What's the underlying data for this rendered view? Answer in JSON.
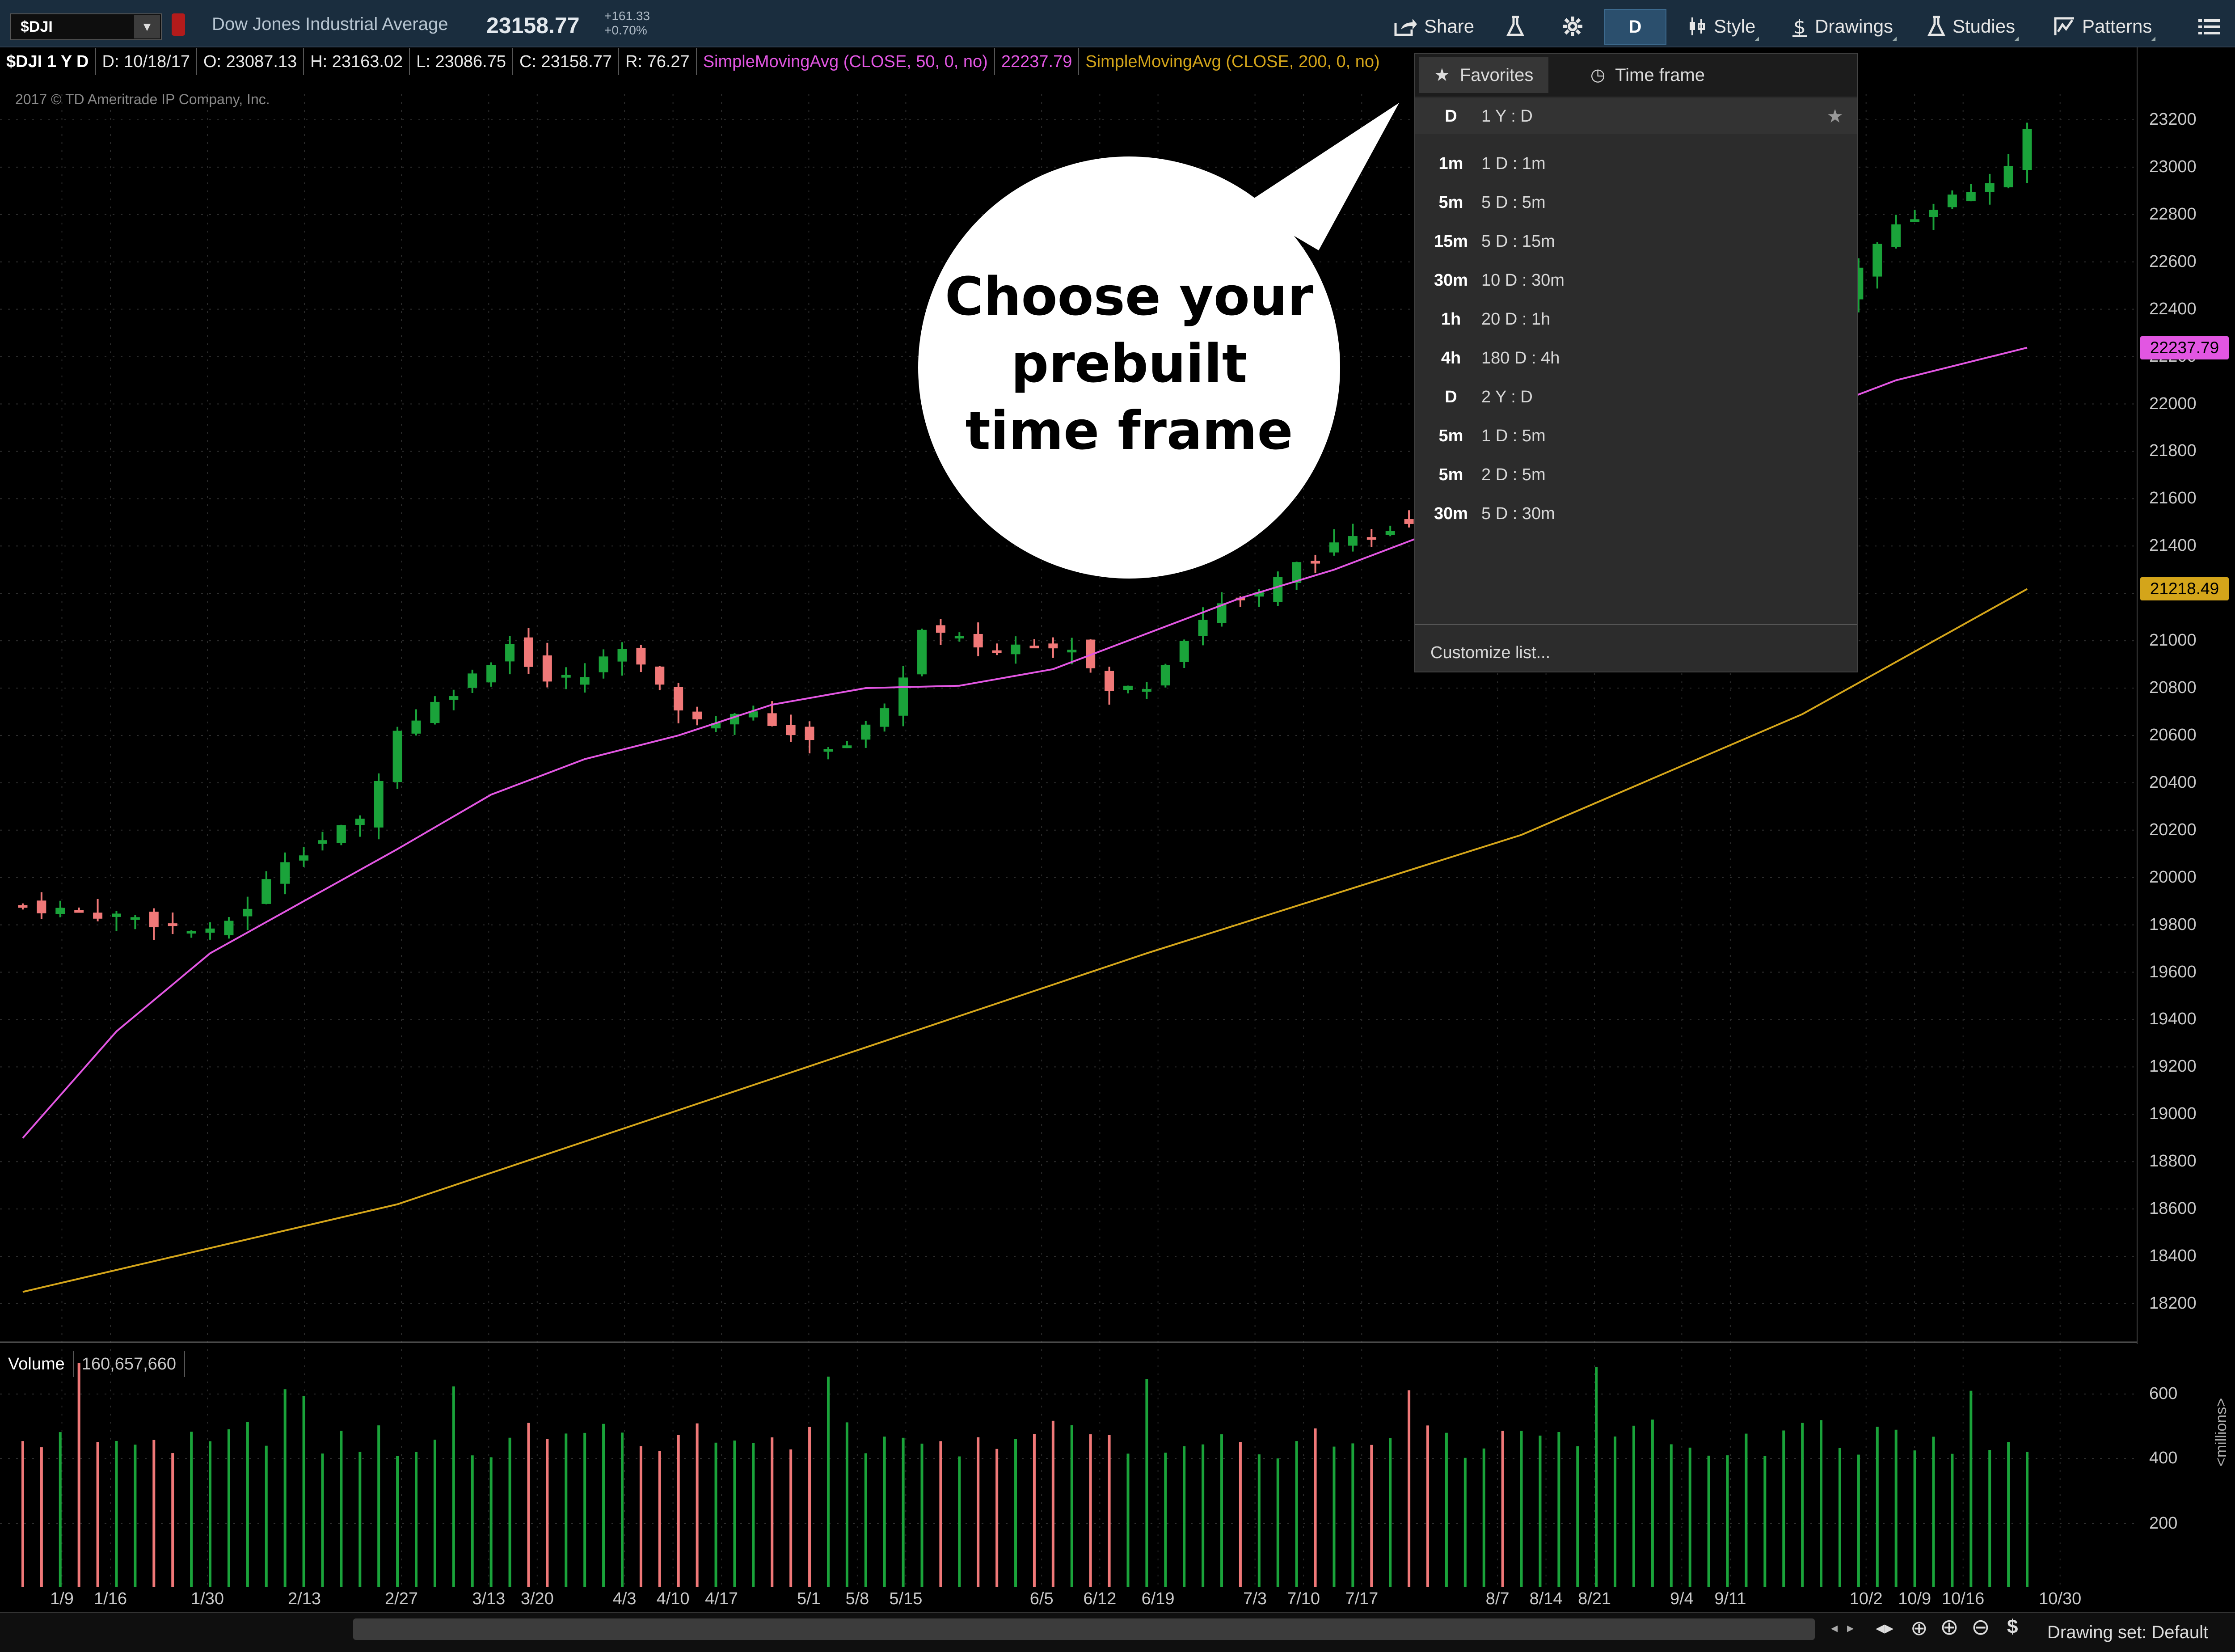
{
  "toolbar": {
    "symbol": "$DJI",
    "name": "Dow Jones Industrial Average",
    "price": "23158.77",
    "change": "+161.33",
    "change_pct": "+0.70%",
    "share": "Share",
    "period": "D",
    "style": "Style",
    "drawings": "Drawings",
    "studies": "Studies",
    "patterns": "Patterns"
  },
  "infobar": {
    "symbol_tf": "$DJI 1 Y D",
    "date": "D: 10/18/17",
    "open": "O: 23087.13",
    "high": "H: 23163.02",
    "low": "L: 23086.75",
    "close": "C: 23158.77",
    "range": "R: 76.27",
    "sma50_label": "SimpleMovingAvg (CLOSE, 50, 0, no)",
    "sma50_value": "22237.79",
    "sma200_label": "SimpleMovingAvg (CLOSE, 200, 0, no)"
  },
  "copyright": "2017 © TD Ameritrade IP Company, Inc.",
  "panel": {
    "tab_favorites": "Favorites",
    "tab_timeframe": "Time frame",
    "favorite": {
      "agg": "D",
      "label": "1 Y : D"
    },
    "items": [
      {
        "agg": "1m",
        "label": "1 D : 1m"
      },
      {
        "agg": "5m",
        "label": "5 D : 5m"
      },
      {
        "agg": "15m",
        "label": "5 D : 15m"
      },
      {
        "agg": "30m",
        "label": "10 D : 30m"
      },
      {
        "agg": "1h",
        "label": "20 D : 1h"
      },
      {
        "agg": "4h",
        "label": "180 D : 4h"
      },
      {
        "agg": "D",
        "label": "2 Y : D"
      },
      {
        "agg": "5m",
        "label": "1 D : 5m"
      },
      {
        "agg": "5m",
        "label": "2 D : 5m"
      },
      {
        "agg": "30m",
        "label": "5 D : 30m"
      }
    ],
    "customize": "Customize list..."
  },
  "callout": {
    "line1": "Choose your",
    "line2": "prebuilt",
    "line3": "time frame"
  },
  "volume": {
    "label": "Volume",
    "value": "160,657,660",
    "unit": "<millions>"
  },
  "status": {
    "drawing_set": "Drawing set: Default"
  },
  "colors": {
    "up": "#1aa33a",
    "down": "#f07878",
    "sma50": "#e256e2",
    "sma200": "#d4a51a",
    "panel_bg": "#2c2c2c",
    "toolbar_bg": "#1a2d3e"
  },
  "chart_data": {
    "type": "candlestick",
    "price_ticks": [
      "23200",
      "23000",
      "22800",
      "22600",
      "22400",
      "22200",
      "22000",
      "21800",
      "21600",
      "21400",
      "21200",
      "21000",
      "20800",
      "20600",
      "20400",
      "20200",
      "20000",
      "19800",
      "19600",
      "19400",
      "19200",
      "19000",
      "18800",
      "18600",
      "18400",
      "18200"
    ],
    "volume_ticks": [
      "600",
      "400",
      "200"
    ],
    "x_ticks": [
      "1/9",
      "1/16",
      "1/30",
      "2/13",
      "2/27",
      "3/13",
      "3/20",
      "4/3",
      "4/10",
      "4/17",
      "5/1",
      "5/8",
      "5/15",
      "6/5",
      "6/12",
      "6/19",
      "7/3",
      "7/10",
      "7/17",
      "8/7",
      "8/14",
      "8/21",
      "9/4",
      "9/11",
      "10/2",
      "10/9",
      "10/16",
      "10/30"
    ],
    "price_tags": [
      {
        "value": "22237.79",
        "series": "sma50"
      },
      {
        "value": "21218.49",
        "series": "sma200"
      }
    ],
    "close_path": [
      [
        0,
        19880
      ],
      [
        6,
        19830
      ],
      [
        10,
        19760
      ],
      [
        12,
        19880
      ],
      [
        14,
        20080
      ],
      [
        18,
        20240
      ],
      [
        20,
        20620
      ],
      [
        24,
        20850
      ],
      [
        26,
        20990
      ],
      [
        28,
        20830
      ],
      [
        30,
        20850
      ],
      [
        32,
        20990
      ],
      [
        34,
        20790
      ],
      [
        36,
        20650
      ],
      [
        38,
        20700
      ],
      [
        40,
        20660
      ],
      [
        42,
        20560
      ],
      [
        44,
        20570
      ],
      [
        46,
        20690
      ],
      [
        48,
        21040
      ],
      [
        52,
        20960
      ],
      [
        54,
        21000
      ],
      [
        56,
        20980
      ],
      [
        58,
        20780
      ],
      [
        60,
        20820
      ],
      [
        62,
        21020
      ],
      [
        64,
        21160
      ],
      [
        66,
        21190
      ],
      [
        68,
        21320
      ],
      [
        70,
        21390
      ],
      [
        72,
        21450
      ],
      [
        74,
        21520
      ],
      [
        76,
        21560
      ],
      [
        78,
        21600
      ],
      [
        80,
        21620
      ],
      [
        82,
        21680
      ],
      [
        84,
        21800
      ],
      [
        86,
        21880
      ],
      [
        88,
        22000
      ],
      [
        90,
        22050
      ],
      [
        92,
        22110
      ],
      [
        94,
        22240
      ],
      [
        96,
        22350
      ],
      [
        98,
        22560
      ],
      [
        100,
        22760
      ],
      [
        102,
        22840
      ],
      [
        104,
        22900
      ],
      [
        106,
        22980
      ],
      [
        107,
        23158
      ]
    ],
    "sma50_path": [
      [
        0,
        18900
      ],
      [
        5,
        19350
      ],
      [
        10,
        19680
      ],
      [
        15,
        19900
      ],
      [
        20,
        20120
      ],
      [
        25,
        20350
      ],
      [
        30,
        20500
      ],
      [
        35,
        20600
      ],
      [
        40,
        20730
      ],
      [
        45,
        20800
      ],
      [
        50,
        20810
      ],
      [
        55,
        20880
      ],
      [
        60,
        21030
      ],
      [
        65,
        21180
      ],
      [
        70,
        21300
      ],
      [
        75,
        21450
      ],
      [
        80,
        21580
      ],
      [
        85,
        21680
      ],
      [
        90,
        21790
      ],
      [
        95,
        21950
      ],
      [
        100,
        22100
      ],
      [
        107,
        22237.79
      ]
    ],
    "sma200_path": [
      [
        0,
        18250
      ],
      [
        20,
        18620
      ],
      [
        40,
        19150
      ],
      [
        60,
        19680
      ],
      [
        80,
        20180
      ],
      [
        95,
        20690
      ],
      [
        107,
        21218.49
      ]
    ]
  }
}
